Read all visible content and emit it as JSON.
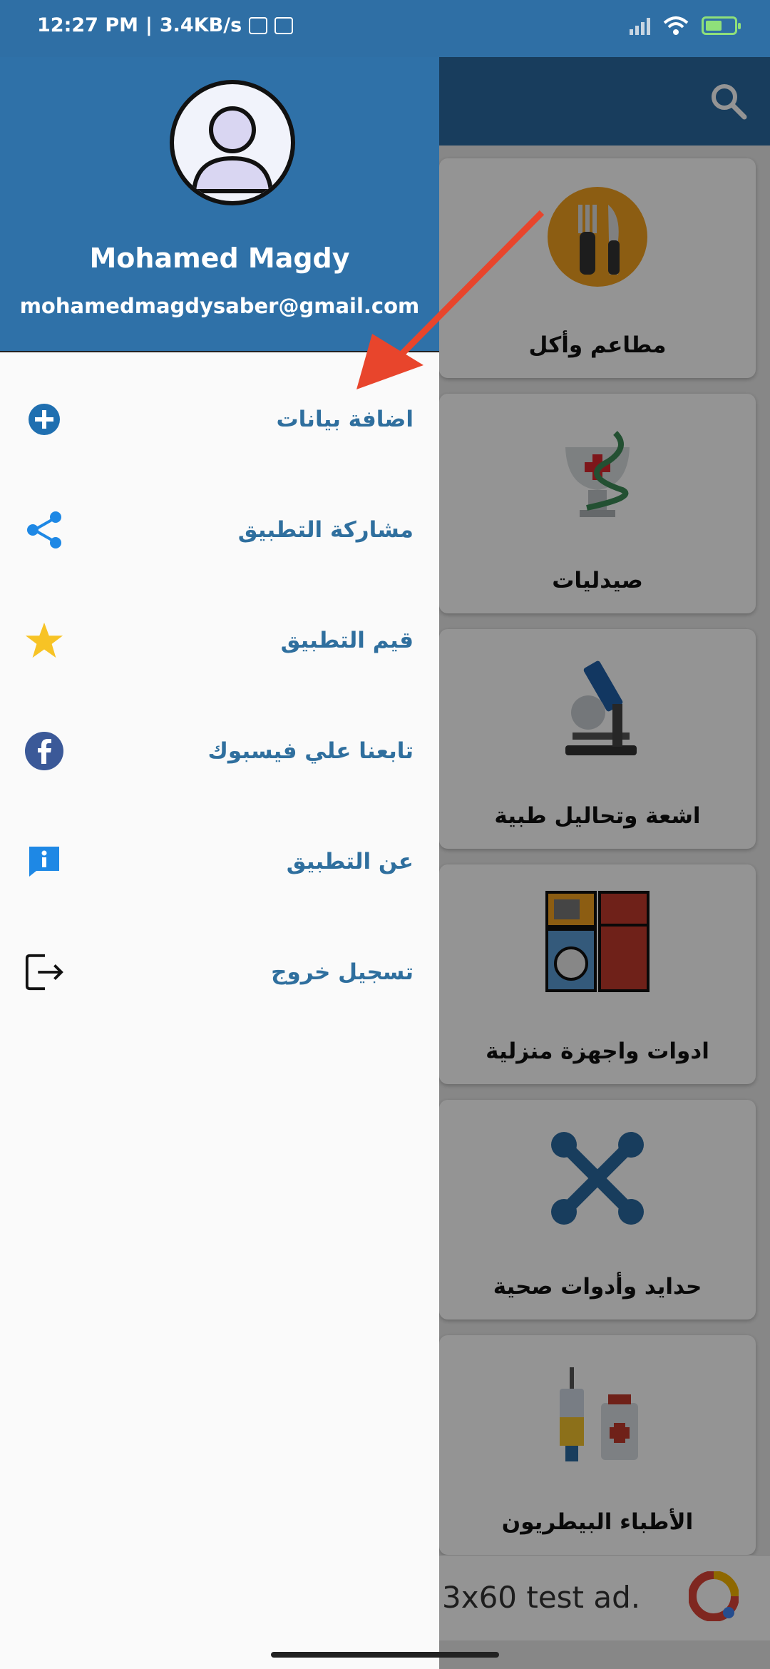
{
  "status_bar": {
    "time": "12:27 PM",
    "network_speed": "3.4KB/s",
    "icons": [
      "gallery-icon",
      "screen-icon",
      "signal-icon",
      "wifi-icon",
      "battery-charging-icon"
    ]
  },
  "drawer": {
    "user_name": "Mohamed Magdy",
    "user_email": "mohamedmagdysaber@gmail.com",
    "menu": [
      {
        "label": "اضافة بيانات",
        "icon": "add-circle-icon",
        "color": "#1f6fb0"
      },
      {
        "label": "مشاركة التطبيق",
        "icon": "share-icon",
        "color": "#1e88e5"
      },
      {
        "label": "قيم التطبيق",
        "icon": "star-icon",
        "color": "#f7c325"
      },
      {
        "label": "تابعنا علي فيسبوك",
        "icon": "facebook-icon",
        "color": "#3b5998"
      },
      {
        "label": "عن التطبيق",
        "icon": "info-icon",
        "color": "#1e88e5"
      },
      {
        "label": "تسجيل خروج",
        "icon": "logout-icon",
        "color": "#111111"
      }
    ]
  },
  "categories": [
    {
      "label": "مطاعم وأكل",
      "icon": "restaurant-icon"
    },
    {
      "label": "صيدليات",
      "icon": "pharmacy-icon"
    },
    {
      "label": "اشعة وتحاليل طبية",
      "icon": "microscope-icon"
    },
    {
      "label": "ادوات واجهزة منزلية",
      "icon": "home-appliances-icon"
    },
    {
      "label": "حدايد وأدوات صحية",
      "icon": "tools-icon"
    },
    {
      "label": "الأطباء البيطريون",
      "icon": "vet-medicine-icon"
    }
  ],
  "ad": {
    "text": "3x60 test ad."
  },
  "colors": {
    "primary": "#2f71a8",
    "menu_text": "#2f6f9e",
    "annotation_arrow": "#e8452c"
  }
}
